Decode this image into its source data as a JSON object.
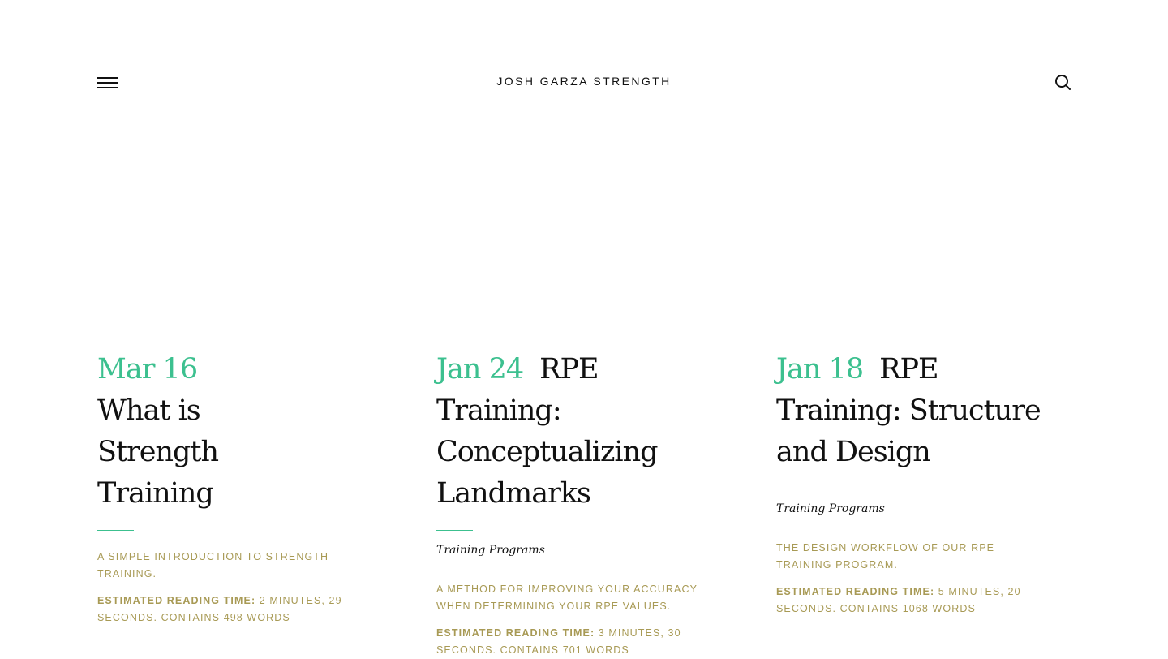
{
  "header": {
    "site_title": "JOSH GARZA STRENGTH",
    "menu_icon": "hamburger-menu-icon",
    "search_icon": "search-icon"
  },
  "colors": {
    "accent_green": "#3cc08f",
    "meta_gold": "#a89a55",
    "text": "#111111"
  },
  "posts": [
    {
      "date": "Mar 16",
      "title": "What is Strength Training",
      "category": "",
      "excerpt": "A SIMPLE INTRODUCTION TO STRENGTH TRAINING.",
      "reading_label": "ESTIMATED READING TIME:",
      "reading_value": "2 MINUTES, 29 SECONDS. CONTAINS 498 WORDS"
    },
    {
      "date": "Jan 24",
      "title": "RPE Training: Conceptualizing Landmarks",
      "category": "Training Programs",
      "excerpt": "A METHOD FOR IMPROVING YOUR ACCURACY WHEN DETERMINING YOUR RPE VALUES.",
      "reading_label": "ESTIMATED READING TIME:",
      "reading_value": "3 MINUTES, 30 SECONDS. CONTAINS 701 WORDS"
    },
    {
      "date": "Jan 18",
      "title": "RPE Training: Structure and Design",
      "category": "Training Programs",
      "excerpt": "THE DESIGN WORKFLOW OF OUR RPE TRAINING PROGRAM.",
      "reading_label": "ESTIMATED READING TIME:",
      "reading_value": "5 MINUTES, 20 SECONDS. CONTAINS 1068 WORDS"
    }
  ]
}
